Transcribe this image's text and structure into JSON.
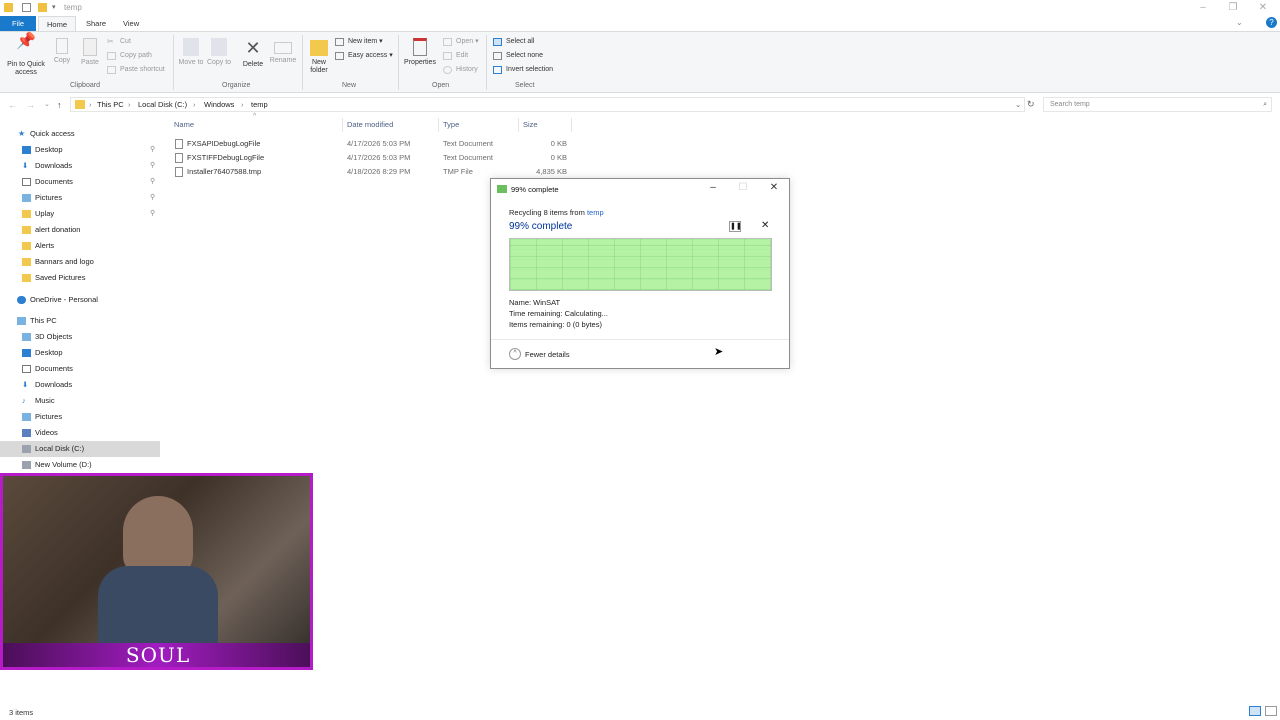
{
  "window": {
    "title": "temp"
  },
  "tabs": [
    "File",
    "Home",
    "Share",
    "View"
  ],
  "ribbon": {
    "clipboard": {
      "pin": "Pin to Quick access",
      "copy": "Copy",
      "paste": "Paste",
      "cut": "Cut",
      "copy_path": "Copy path",
      "paste_shortcut": "Paste shortcut",
      "label": "Clipboard"
    },
    "organize": {
      "move_to": "Move to",
      "copy_to": "Copy to",
      "delete": "Delete",
      "rename": "Rename",
      "label": "Organize"
    },
    "new": {
      "new_folder": "New folder",
      "new_item": "New item",
      "easy_access": "Easy access",
      "label": "New"
    },
    "open": {
      "properties": "Properties",
      "open": "Open",
      "edit": "Edit",
      "history": "History",
      "label": "Open"
    },
    "select": {
      "select_all": "Select all",
      "select_none": "Select none",
      "invert": "Invert selection",
      "label": "Select"
    }
  },
  "address": {
    "crumbs": [
      "This PC",
      "Local Disk (C:)",
      "Windows",
      "temp"
    ],
    "search_placeholder": "Search temp"
  },
  "nav": {
    "quick_access": "Quick access",
    "quick_items": [
      "Desktop",
      "Downloads",
      "Documents",
      "Pictures",
      "Uplay",
      "alert donation",
      "Alerts",
      "Bannars and logo",
      "Saved Pictures"
    ],
    "onedrive": "OneDrive - Personal",
    "this_pc": "This PC",
    "pc_items": [
      "3D Objects",
      "Desktop",
      "Documents",
      "Downloads",
      "Music",
      "Pictures",
      "Videos",
      "Local Disk (C:)",
      "New Volume (D:)"
    ]
  },
  "columns": {
    "name": "Name",
    "date": "Date modified",
    "type": "Type",
    "size": "Size"
  },
  "files": [
    {
      "name": "FXSAPIDebugLogFile",
      "date": "4/17/2026 5:03 PM",
      "type": "Text Document",
      "size": "0 KB"
    },
    {
      "name": "FXSTIFFDebugLogFile",
      "date": "4/17/2026 5:03 PM",
      "type": "Text Document",
      "size": "0 KB"
    },
    {
      "name": "Installer76407588.tmp",
      "date": "4/18/2026 8:29 PM",
      "type": "TMP File",
      "size": "4,835 KB"
    }
  ],
  "dialog": {
    "title": "99% complete",
    "recycling_prefix": "Recycling 8 items from",
    "recycling_link": "temp",
    "heading": "99% complete",
    "progress": 0.99,
    "name": "Name:  WinSAT",
    "time_remaining": "Time remaining:  Calculating...",
    "items_remaining": "Items remaining:  0 (0 bytes)",
    "fewer_details": "Fewer details"
  },
  "webcam": {
    "brand": "SOUL"
  },
  "status": {
    "items": "3 items"
  },
  "colors": {
    "accent": "#1979ca",
    "progress": "#b5f2a3",
    "frame": "#b51cc8"
  }
}
